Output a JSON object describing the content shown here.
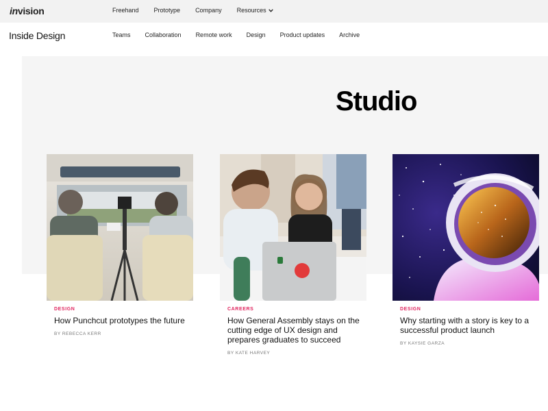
{
  "topbar": {
    "logo_prefix": "in",
    "logo_suffix": "vision",
    "nav": [
      "Freehand",
      "Prototype",
      "Company",
      "Resources"
    ]
  },
  "subbar": {
    "brand": "Inside Design",
    "nav": [
      "Teams",
      "Collaboration",
      "Remote work",
      "Design",
      "Product updates",
      "Archive"
    ]
  },
  "hero": {
    "title": "Studio"
  },
  "cards": [
    {
      "category": "DESIGN",
      "title": "How Punchcut prototypes the future",
      "author": "BY REBECCA KERR"
    },
    {
      "category": "CAREERS",
      "title": "How General Assembly stays on the cutting edge of UX design and prepares graduates to succeed",
      "author": "BY KATE HARVEY"
    },
    {
      "category": "DESIGN",
      "title": "Why starting with a story is key to a successful product launch",
      "author": "BY KAYSIE GARZA"
    }
  ],
  "colors": {
    "accent": "#e0245e",
    "topbar_bg": "#f2f2f2",
    "hero_bg": "#f5f5f5"
  }
}
